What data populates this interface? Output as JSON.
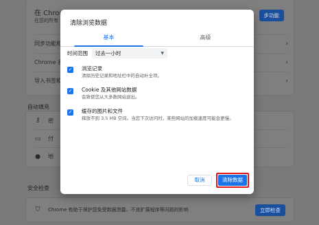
{
  "background": {
    "card1_rows": [
      {
        "text": "在 Chrome",
        "sub": "在您的所有"
      },
      {
        "text": "同步功能和"
      },
      {
        "text": "Chrome 名"
      },
      {
        "text": "导入书签和"
      }
    ],
    "sync_button_label": "步功能",
    "autofill_heading": "自动填充",
    "autofill_rows": [
      {
        "icon": "key-icon",
        "text": "密"
      },
      {
        "icon": "card-icon",
        "text": "付"
      },
      {
        "icon": "location-icon",
        "text": "地"
      }
    ],
    "safety_heading": "安全检查",
    "safety_text": "Chrome 有助于保护您免受数据泄露、不良扩展程序等问题的影响",
    "safety_button_label": "立即检查"
  },
  "dialog": {
    "title": "清除浏览数据",
    "tabs": [
      {
        "label": "基本",
        "active": true
      },
      {
        "label": "高级",
        "active": false
      }
    ],
    "time_range_label": "时间范围",
    "time_range_value": "过去一小时",
    "options": [
      {
        "title": "浏览记录",
        "desc": "清除历史记录和地址栏中的自动补全项。",
        "checked": true
      },
      {
        "title": "Cookie 及其他网站数据",
        "desc": "会致使您从大多数网站退出。",
        "checked": true
      },
      {
        "title": "缓存的图片和文件",
        "desc": "释放不到 3.5 MB 空间。当您下次访问时，某些网站的加载速度可能会更慢。",
        "checked": true
      }
    ],
    "cancel_label": "取消",
    "clear_label": "清除数据"
  },
  "colors": {
    "accent": "#1a73e8",
    "highlight_border": "#e3141c"
  }
}
